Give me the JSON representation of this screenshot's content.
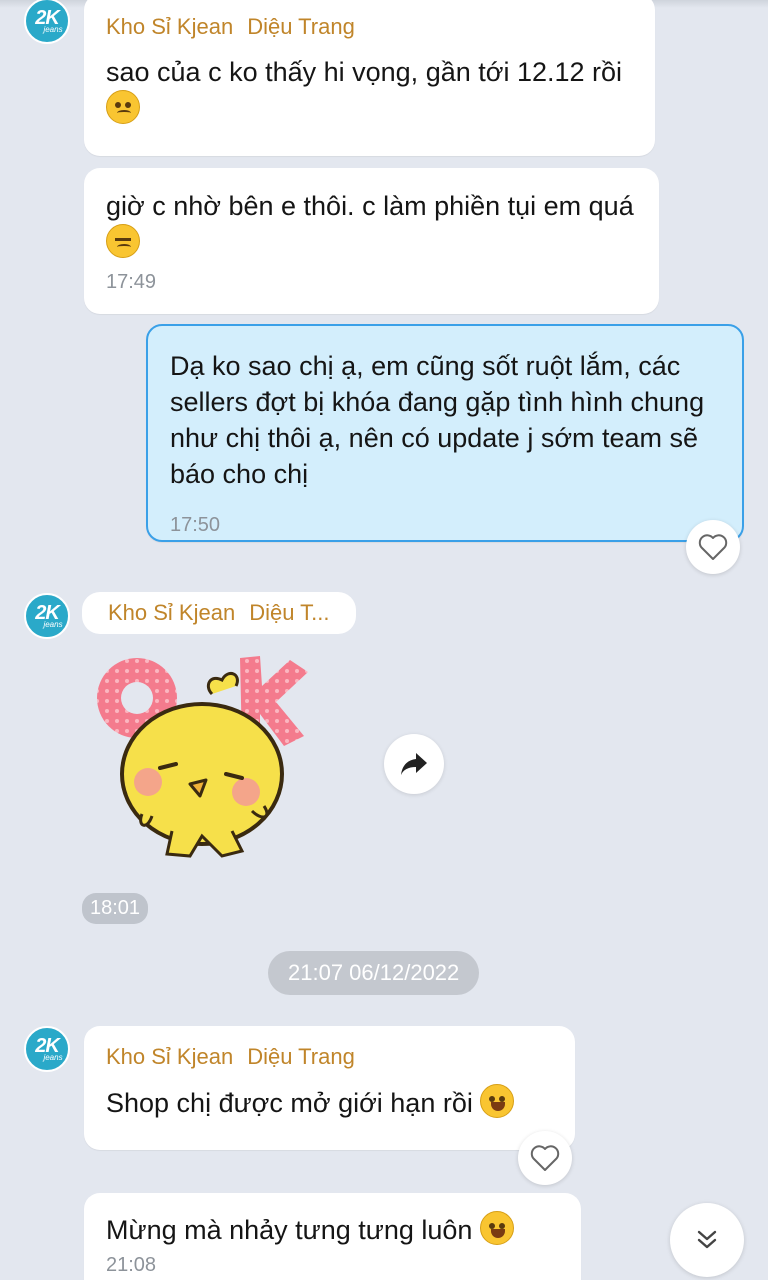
{
  "avatar": {
    "line1": "2K",
    "line2": "jeans"
  },
  "messages": [
    {
      "sender_shop": "Kho Sỉ Kjean",
      "sender_name": "Diệu Trang",
      "text": "sao của c ko thấy hi vọng, gần tới 12.12 rồi",
      "emoji": "worried-face-emoji"
    },
    {
      "text": "giờ c nhờ bên e thôi. c làm phiền tụi em quá",
      "emoji": "persevering-face-emoji",
      "time": "17:49"
    },
    {
      "text": "Dạ ko sao chị ạ, em cũng sốt ruột lắm, các sellers đợt bị khóa đang gặp tình hình chung như chị thôi ạ, nên có update j sớm team sẽ báo cho chị",
      "time": "17:50"
    },
    {
      "sender_shop": "Kho Sỉ Kjean",
      "sender_name": "Diệu T...",
      "sticker_text": "OK",
      "time": "18:01"
    },
    {
      "sender_shop": "Kho Sỉ Kjean",
      "sender_name": "Diệu Trang",
      "text": "Shop chị được mở giới hạn rồi",
      "emoji": "tears-of-joy-emoji"
    },
    {
      "text": "Mừng mà nhảy tưng tưng luôn",
      "emoji": "tears-of-joy-emoji",
      "time": "21:08"
    }
  ],
  "date_separator": "21:07 06/12/2022",
  "icons": {
    "react": "heart-outline-icon",
    "share": "share-arrow-icon",
    "scroll": "double-chevron-down-icon"
  },
  "colors": {
    "background": "#e3e7ef",
    "sender_name": "#c0852a",
    "my_bubble": "#d3eefc",
    "my_bubble_border": "#3aa0e8",
    "avatar": "#2aa9c9"
  }
}
